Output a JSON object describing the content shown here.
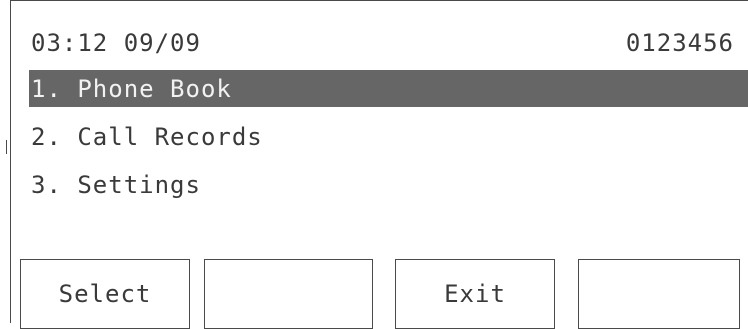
{
  "status_bar": {
    "time": "03:12",
    "date": "09/09",
    "number": "0123456"
  },
  "menu": {
    "items": [
      {
        "label": "1. Phone Book",
        "selected": true
      },
      {
        "label": "2. Call Records",
        "selected": false
      },
      {
        "label": "3. Settings",
        "selected": false
      }
    ]
  },
  "softkeys": [
    {
      "label": "Select"
    },
    {
      "label": ""
    },
    {
      "label": "Exit"
    },
    {
      "label": ""
    }
  ],
  "colors": {
    "highlight_bg": "#666666",
    "highlight_text": "#f2f2f2",
    "text": "#3a3a3a",
    "border": "#4a4a4a"
  }
}
